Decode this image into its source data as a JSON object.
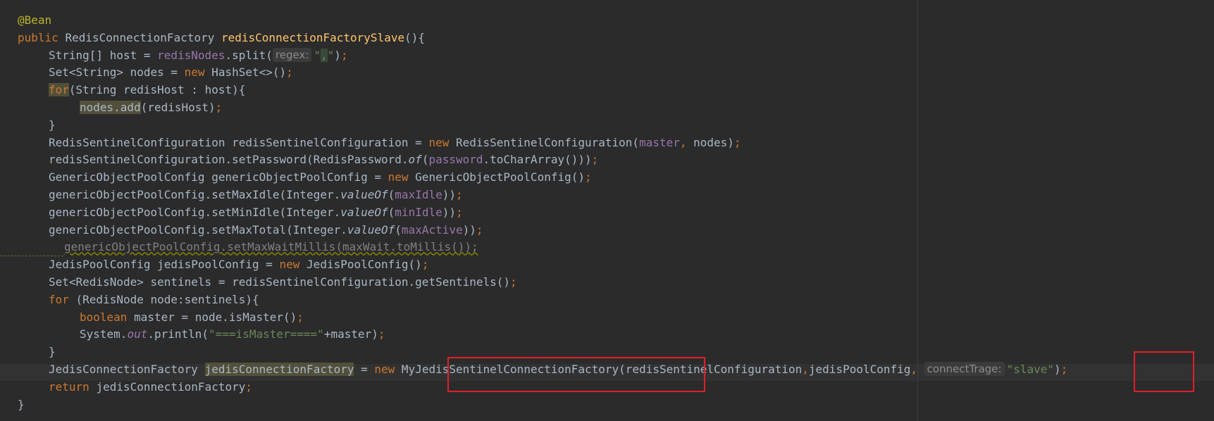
{
  "editor": {
    "lines": [
      {
        "segments": [
          {
            "text": "@Bean",
            "cls": "ann"
          }
        ]
      },
      {
        "segments": [
          {
            "text": "public ",
            "cls": "kw"
          },
          {
            "text": "RedisConnectionFactory "
          },
          {
            "text": "redisConnectionFactorySlave",
            "cls": "fn"
          },
          {
            "text": "(){"
          }
        ]
      },
      {
        "indent": 1,
        "segments": [
          {
            "text": "String[] host = "
          },
          {
            "text": "redisNodes",
            "cls": "field"
          },
          {
            "text": ".split("
          },
          {
            "text": "regex:",
            "cls": "hint"
          },
          {
            "text": "\"",
            "cls": "str"
          },
          {
            "text": ",",
            "cls": "str str-hl"
          },
          {
            "text": "\"",
            "cls": "str"
          },
          {
            "text": ")"
          },
          {
            "text": ";",
            "cls": "semi"
          }
        ]
      },
      {
        "indent": 1,
        "segments": [
          {
            "text": "Set<String> nodes = "
          },
          {
            "text": "new ",
            "cls": "kw"
          },
          {
            "text": "HashSet<>()"
          },
          {
            "text": ";",
            "cls": "semi"
          }
        ]
      },
      {
        "indent": 1,
        "segments": [
          {
            "text": "for",
            "cls": "kw hl-word"
          },
          {
            "text": "(String redisHost : host){"
          }
        ]
      },
      {
        "indent": 2,
        "segments": [
          {
            "text": "nodes.add",
            "cls": "hl-word"
          },
          {
            "text": "(redisHost)"
          },
          {
            "text": ";",
            "cls": "semi"
          }
        ]
      },
      {
        "indent": 1,
        "segments": [
          {
            "text": "}"
          }
        ]
      },
      {
        "indent": 1,
        "segments": [
          {
            "text": "RedisSentinelConfiguration redisSentinelConfiguration = "
          },
          {
            "text": "new ",
            "cls": "kw"
          },
          {
            "text": "RedisSentinelConfiguration("
          },
          {
            "text": "master",
            "cls": "field"
          },
          {
            "text": ", ",
            "cls": "kw"
          },
          {
            "text": "nodes)"
          },
          {
            "text": ";",
            "cls": "semi"
          }
        ]
      },
      {
        "indent": 1,
        "segments": [
          {
            "text": "redisSentinelConfiguration.setPassword(RedisPassword."
          },
          {
            "text": "of",
            "cls": "italic"
          },
          {
            "text": "("
          },
          {
            "text": "password",
            "cls": "field"
          },
          {
            "text": ".toCharArray()))"
          },
          {
            "text": ";",
            "cls": "semi"
          }
        ]
      },
      {
        "indent": 1,
        "segments": [
          {
            "text": "GenericObjectPoolConfig genericObjectPoolConfig = "
          },
          {
            "text": "new ",
            "cls": "kw"
          },
          {
            "text": "GenericObjectPoolConfig()"
          },
          {
            "text": ";",
            "cls": "semi"
          }
        ]
      },
      {
        "indent": 1,
        "segments": [
          {
            "text": "genericObjectPoolConfig.setMaxIdle(Integer."
          },
          {
            "text": "valueOf",
            "cls": "italic"
          },
          {
            "text": "("
          },
          {
            "text": "maxIdle",
            "cls": "field"
          },
          {
            "text": "))"
          },
          {
            "text": ";",
            "cls": "semi"
          }
        ]
      },
      {
        "indent": 1,
        "segments": [
          {
            "text": "genericObjectPoolConfig.setMinIdle(Integer."
          },
          {
            "text": "valueOf",
            "cls": "italic"
          },
          {
            "text": "("
          },
          {
            "text": "minIdle",
            "cls": "field"
          },
          {
            "text": "))"
          },
          {
            "text": ";",
            "cls": "semi"
          }
        ]
      },
      {
        "indent": 1,
        "segments": [
          {
            "text": "genericObjectPoolConfig.setMaxTotal(Integer."
          },
          {
            "text": "valueOf",
            "cls": "italic"
          },
          {
            "text": "("
          },
          {
            "text": "maxActive",
            "cls": "field"
          },
          {
            "text": "))"
          },
          {
            "text": ";",
            "cls": "semi"
          }
        ]
      },
      {
        "indent": 1,
        "extra_indent": 2,
        "segments": [
          {
            "text": "genericObjectPoolConfig.setMaxWaitMillis(maxWait.toMillis());",
            "cls": "unused"
          }
        ]
      },
      {
        "indent": 1,
        "segments": [
          {
            "text": "JedisPoolConfig jedisPoolConfig = "
          },
          {
            "text": "new ",
            "cls": "kw"
          },
          {
            "text": "JedisPoolConfig()"
          },
          {
            "text": ";",
            "cls": "semi"
          }
        ]
      },
      {
        "indent": 1,
        "segments": [
          {
            "text": "Set<RedisNode> sentinels = redisSentinelConfiguration.getSentinels()"
          },
          {
            "text": ";",
            "cls": "semi"
          }
        ]
      },
      {
        "indent": 1,
        "segments": [
          {
            "text": "for ",
            "cls": "kw"
          },
          {
            "text": "(RedisNode node:sentinels){"
          }
        ]
      },
      {
        "indent": 2,
        "segments": [
          {
            "text": "boolean ",
            "cls": "kw"
          },
          {
            "text": "master = node.isMaster()"
          },
          {
            "text": ";",
            "cls": "semi"
          }
        ]
      },
      {
        "indent": 2,
        "segments": [
          {
            "text": "System."
          },
          {
            "text": "out",
            "cls": "field italic"
          },
          {
            "text": ".println("
          },
          {
            "text": "\"===isMaster====\"",
            "cls": "str"
          },
          {
            "text": "+master)"
          },
          {
            "text": ";",
            "cls": "semi"
          }
        ]
      },
      {
        "indent": 1,
        "segments": [
          {
            "text": "}"
          }
        ]
      },
      {
        "indent": 1,
        "segments": [
          {
            "text": "JedisConnectionFactory "
          },
          {
            "text": "jedisConnectionFactory",
            "cls": "hl-word"
          },
          {
            "text": " = "
          },
          {
            "text": "new ",
            "cls": "kw"
          },
          {
            "text": "MyJedisSentinelConnectionFactory(redisSentinelConfiguration"
          },
          {
            "text": ",",
            "cls": "kw"
          },
          {
            "text": "jedisPoolConfig"
          },
          {
            "text": ", ",
            "cls": "kw"
          },
          {
            "text": "connectTrage:",
            "cls": "hint"
          },
          {
            "text": "\"slave\"",
            "cls": "str"
          },
          {
            "text": ")"
          },
          {
            "text": ";",
            "cls": "semi"
          }
        ]
      },
      {
        "indent": 1,
        "segments": [
          {
            "text": "return ",
            "cls": "kw"
          },
          {
            "text": "jedisConnectionFactory"
          },
          {
            "text": ";",
            "cls": "semi"
          }
        ]
      },
      {
        "segments": [
          {
            "text": "}"
          }
        ]
      }
    ]
  },
  "colors": {
    "background": "#2b2b2b",
    "keyword": "#cc7832",
    "annotation": "#bbb529",
    "method_declaration": "#ffc66d",
    "field": "#9876aa",
    "string": "#6a8759",
    "annotation_box": "#e0202a"
  }
}
